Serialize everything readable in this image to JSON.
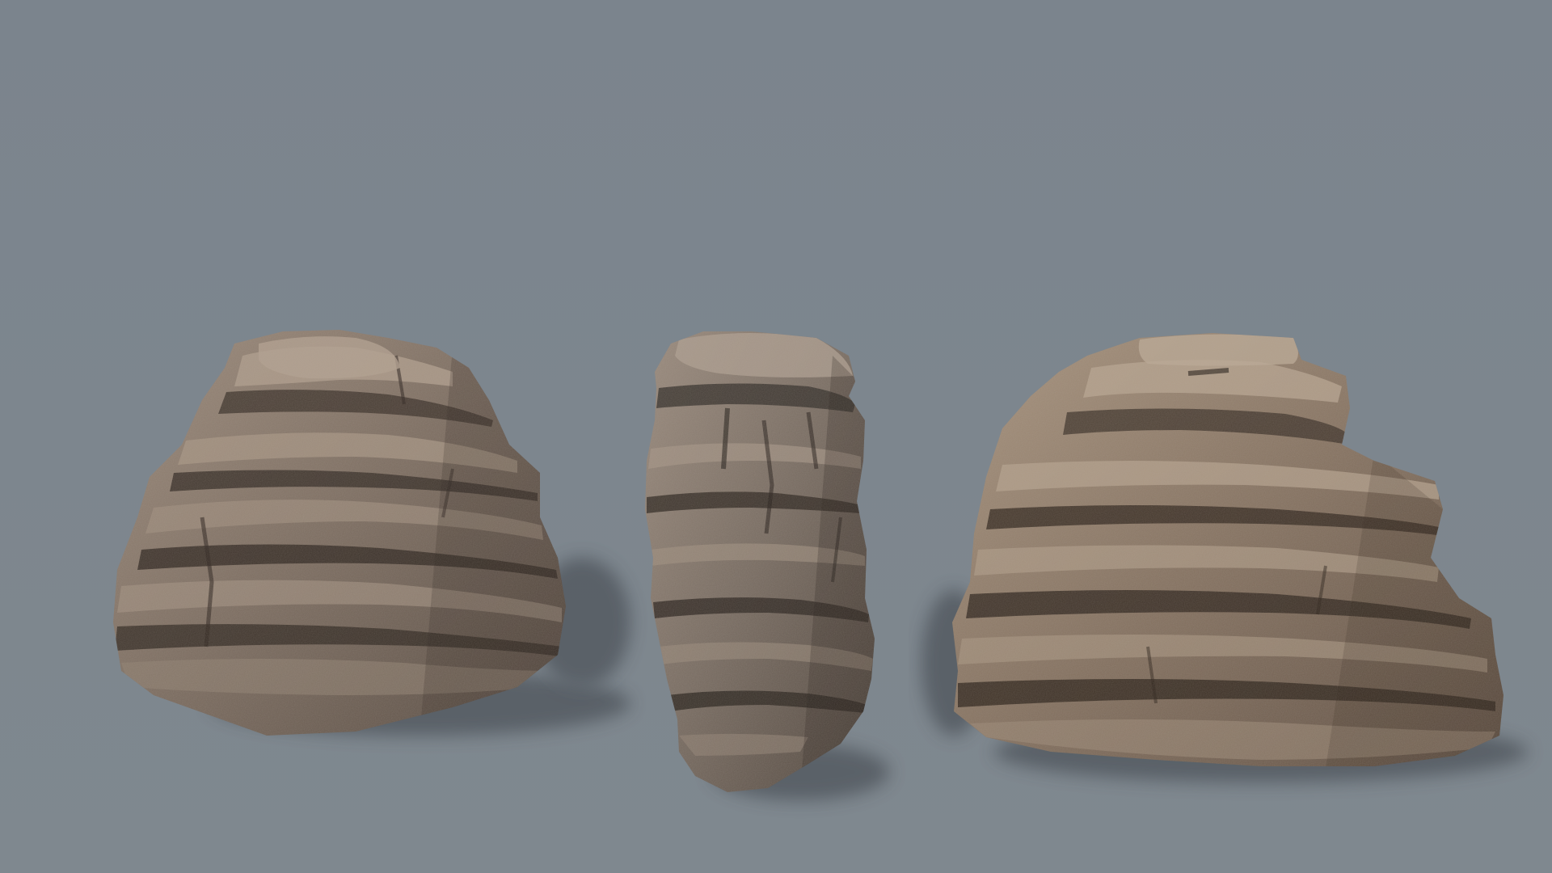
{
  "scene": {
    "background": "#7c858e",
    "rocks": [
      {
        "name": "rock-left",
        "base": "#7a6c60",
        "light": "#a69585",
        "dark": "#3a3029"
      },
      {
        "name": "rock-middle",
        "base": "#766a60",
        "light": "#a49486",
        "dark": "#362e28"
      },
      {
        "name": "rock-right",
        "base": "#82705f",
        "light": "#ae9b88",
        "dark": "#3c3028"
      }
    ]
  }
}
